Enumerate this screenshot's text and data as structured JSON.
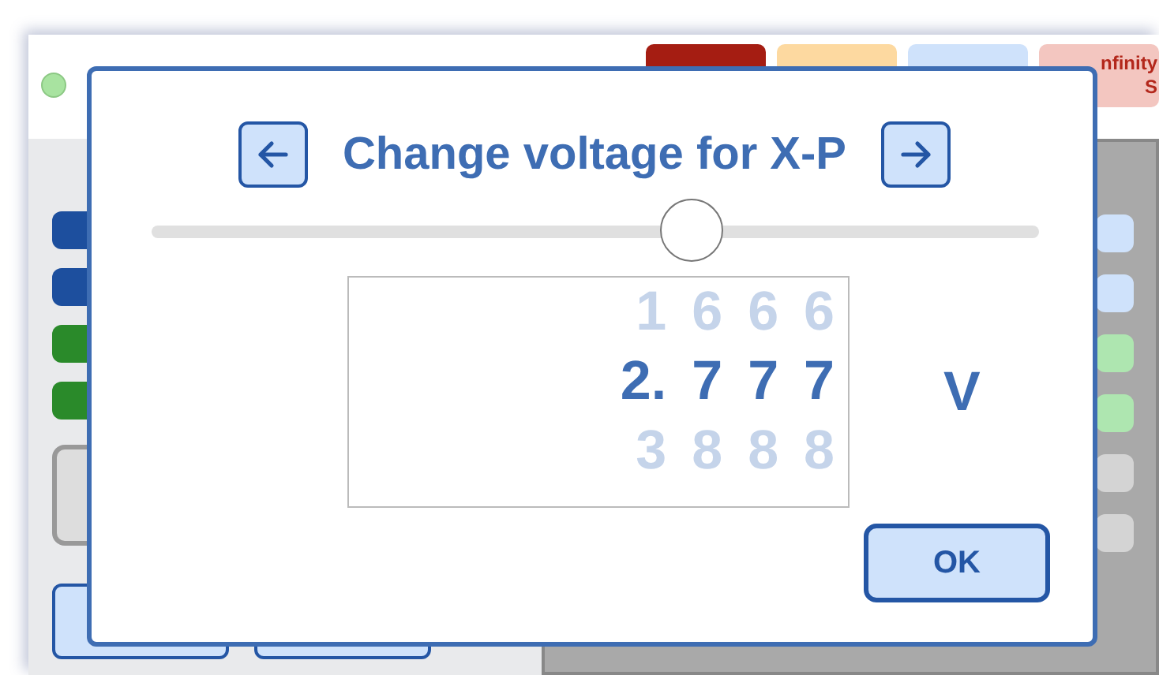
{
  "status_light": {
    "on": true
  },
  "badges": [
    {
      "color": "#a51d12"
    },
    {
      "color": "#fdd9a0"
    },
    {
      "color": "#cfe2fb"
    },
    {
      "color": "#f3c6c0",
      "label": "nfinity S"
    }
  ],
  "left_tags": [
    {
      "color": "#1d4f9e"
    },
    {
      "color": "#1d4f9e"
    },
    {
      "color": "#2a8a2a"
    },
    {
      "color": "#2a8a2a"
    }
  ],
  "right_tags": [
    {
      "color": "#cfe2fb"
    },
    {
      "color": "#cfe2fb"
    },
    {
      "color": "#aee6b0"
    },
    {
      "color": "#aee6b0"
    },
    {
      "color": "#d4d4d4"
    },
    {
      "color": "#d4d4d4"
    }
  ],
  "dialog": {
    "title": "Change voltage for X-P",
    "slider": {
      "level": 0.61
    },
    "digits": [
      {
        "above": "1",
        "value": "2.",
        "below": "3"
      },
      {
        "above": "6",
        "value": "7",
        "below": "8"
      },
      {
        "above": "6",
        "value": "7",
        "below": "8"
      },
      {
        "above": "6",
        "value": "7",
        "below": "8"
      }
    ],
    "unit": "V",
    "ok_button": "OK"
  }
}
